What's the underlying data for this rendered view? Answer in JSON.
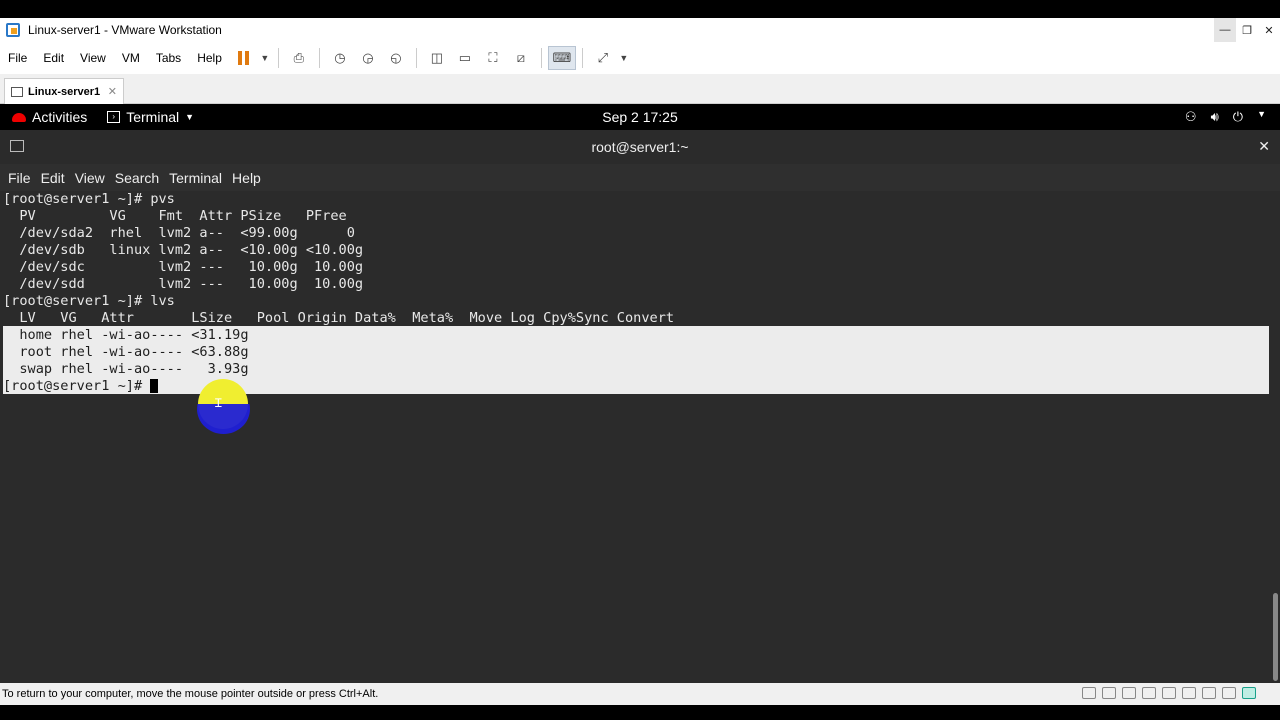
{
  "vmware": {
    "window_title": "Linux-server1 - VMware Workstation",
    "menu": [
      "File",
      "Edit",
      "View",
      "VM",
      "Tabs",
      "Help"
    ],
    "tab_label": "Linux-server1",
    "status_text": "To return to your computer, move the mouse pointer outside or press Ctrl+Alt."
  },
  "gnome": {
    "activities": "Activities",
    "app_menu": "Terminal",
    "clock": "Sep 2  17:25"
  },
  "terminal": {
    "title": "root@server1:~",
    "menu": [
      "File",
      "Edit",
      "View",
      "Search",
      "Terminal",
      "Help"
    ],
    "lines": [
      "[root@server1 ~]# pvs",
      "  PV         VG    Fmt  Attr PSize   PFree",
      "  /dev/sda2  rhel  lvm2 a--  <99.00g      0",
      "  /dev/sdb   linux lvm2 a--  <10.00g <10.00g",
      "  /dev/sdc         lvm2 ---   10.00g  10.00g",
      "  /dev/sdd         lvm2 ---   10.00g  10.00g",
      "[root@server1 ~]# lvs",
      "  LV   VG   Attr       LSize   Pool Origin Data%  Meta%  Move Log Cpy%Sync Convert"
    ],
    "selected_lines": [
      "  home rhel -wi-ao---- <31.19g",
      "  root rhel -wi-ao---- <63.88g",
      "  swap rhel -wi-ao----   3.93g",
      "[root@server1 ~]# "
    ]
  }
}
